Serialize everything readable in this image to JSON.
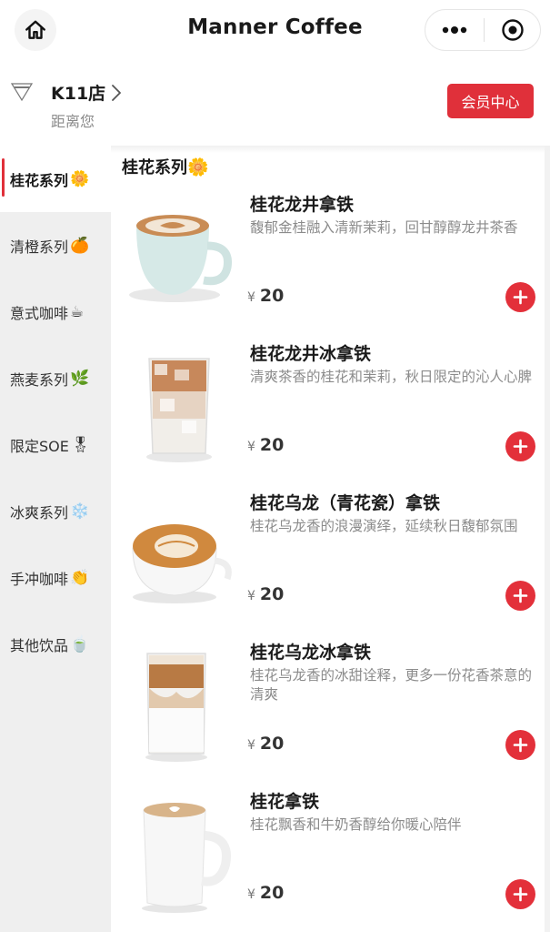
{
  "app": {
    "title": "Manner Coffee"
  },
  "store": {
    "name": "K11店",
    "distance_label": "距离您",
    "member_button": "会员中心"
  },
  "sidebar": {
    "items": [
      {
        "label": "桂花系列",
        "emoji": "🌼",
        "active": true
      },
      {
        "label": "清橙系列",
        "emoji": "🍊",
        "active": false
      },
      {
        "label": "意式咖啡",
        "emoji": "☕",
        "active": false
      },
      {
        "label": "燕麦系列",
        "emoji": "🌿",
        "active": false
      },
      {
        "label": "限定SOE",
        "emoji": "🎖",
        "active": false
      },
      {
        "label": "冰爽系列",
        "emoji": "❄️",
        "active": false
      },
      {
        "label": "手冲咖啡",
        "emoji": "👏",
        "active": false
      },
      {
        "label": "其他饮品",
        "emoji": "🍵",
        "active": false
      }
    ]
  },
  "section": {
    "title": "桂花系列",
    "emoji": "🌼"
  },
  "products": [
    {
      "name": "桂花龙井拿铁",
      "desc": "馥郁金桂融入清新茉莉，回甘醇醇龙井茶香",
      "currency": "¥",
      "price": "20",
      "image": "hot-latte-cup"
    },
    {
      "name": "桂花龙井冰拿铁",
      "desc": "清爽茶香的桂花和茉莉，秋日限定的沁人心脾",
      "currency": "¥",
      "price": "20",
      "image": "iced-latte-glass"
    },
    {
      "name": "桂花乌龙（青花瓷）拿铁",
      "desc": "桂花乌龙香的浪漫演绎，延续秋日馥郁氛围",
      "currency": "¥",
      "price": "20",
      "image": "latte-art-cup"
    },
    {
      "name": "桂花乌龙冰拿铁",
      "desc": "桂花乌龙香的冰甜诠释，更多一份花香茶意的清爽",
      "currency": "¥",
      "price": "20",
      "image": "layered-iced-latte"
    },
    {
      "name": "桂花拿铁",
      "desc": "桂花飘香和牛奶香醇给你暖心陪伴",
      "currency": "¥",
      "price": "20",
      "image": "white-mug-latte"
    }
  ],
  "colors": {
    "accent": "#e0303a",
    "sidebar_bg": "#efefef"
  }
}
